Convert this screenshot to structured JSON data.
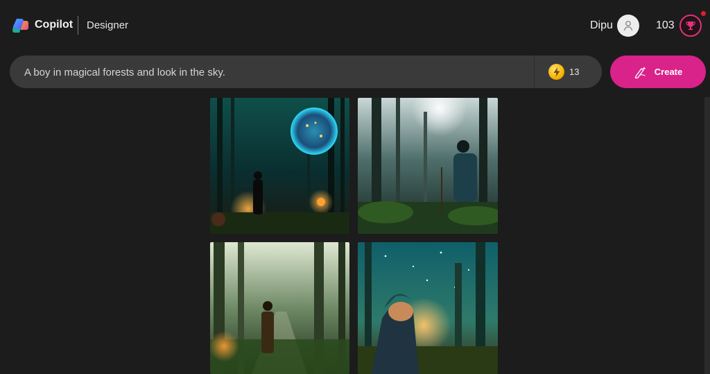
{
  "header": {
    "brand": "Copilot",
    "product": "Designer",
    "user_name": "Dipu",
    "boosts_total": "103",
    "icons": {
      "logo": "copilot-logo",
      "avatar": "person-icon",
      "rewards": "trophy-icon"
    }
  },
  "prompt": {
    "text": "A boy in magical forests and look in the sky.",
    "boosts": "13",
    "boost_icon": "lightning-icon"
  },
  "create_button": {
    "label": "Create",
    "icon": "sparkle-pen-icon",
    "color": "#d9228a"
  },
  "results": {
    "count": 4,
    "images": [
      {
        "id": "result-1",
        "theme": "glowing sphere in forest"
      },
      {
        "id": "result-2",
        "theme": "boy with backpack in misty forest"
      },
      {
        "id": "result-3",
        "theme": "boy on forest path in light beams"
      },
      {
        "id": "result-4",
        "theme": "boy in hood looking at starry sky"
      }
    ]
  }
}
